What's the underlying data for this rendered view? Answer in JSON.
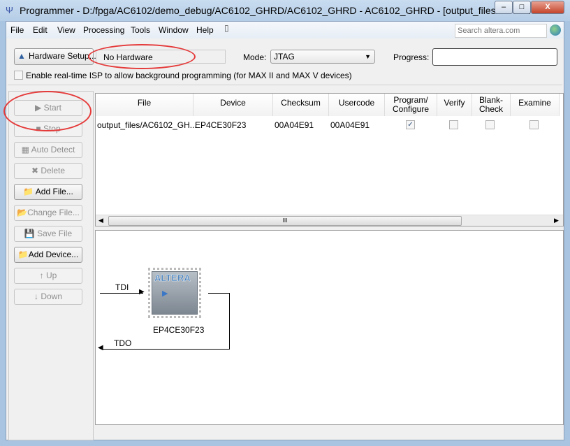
{
  "window": {
    "title": "Programmer - D:/fpga/AC6102/demo_debug/AC6102_GHRD/AC6102_GHRD - AC6102_GHRD - [output_files/AC61...",
    "minimize": "–",
    "maximize": "□",
    "close": "X"
  },
  "menu": [
    "File",
    "Edit",
    "View",
    "Processing",
    "Tools",
    "Window",
    "Help"
  ],
  "search": {
    "placeholder": "Search altera.com"
  },
  "hardware": {
    "setup_label": "Hardware Setup...",
    "value": "No Hardware",
    "mode_label": "Mode:",
    "mode_value": "JTAG",
    "progress_label": "Progress:"
  },
  "isp": {
    "label": "Enable real-time ISP to allow background programming (for MAX II and MAX V devices)",
    "checked": false
  },
  "buttons": {
    "start": "Start",
    "stop": "Stop",
    "auto_detect": "Auto Detect",
    "delete": "Delete",
    "add_file": "Add File...",
    "change_file": "Change File...",
    "save_file": "Save File",
    "add_device": "Add Device...",
    "up": "Up",
    "down": "Down"
  },
  "table": {
    "columns": [
      "File",
      "Device",
      "Checksum",
      "Usercode",
      "Program/\nConfigure",
      "Verify",
      "Blank-\nCheck",
      "Examine"
    ],
    "rows": [
      {
        "file": "output_files/AC6102_GH...",
        "device": "EP4CE30F23",
        "checksum": "00A04E91",
        "usercode": "00A04E91",
        "program": true,
        "verify": false,
        "blank": false,
        "examine": false
      }
    ]
  },
  "scroll": {
    "grip": "III"
  },
  "chain": {
    "tdi": "TDI",
    "tdo": "TDO",
    "device": "EP4CE30F23",
    "logo": "ALTERA"
  }
}
